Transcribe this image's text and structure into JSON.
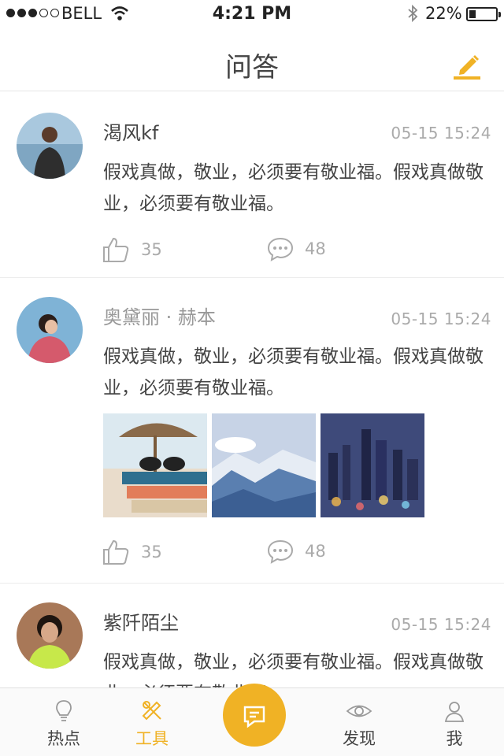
{
  "status_bar": {
    "carrier": "BELL",
    "time": "4:21 PM",
    "battery": "22%",
    "battery_level": 0.22
  },
  "navbar": {
    "title": "问答",
    "compose_icon": "pencil-icon"
  },
  "posts": [
    {
      "username": "渴风kf",
      "time": "05-15  15:24",
      "content": "假戏真做，敬业，必须要有敬业福。假戏真做敬业，必须要有敬业福。",
      "likes": "35",
      "comments": "48"
    },
    {
      "username": "奥黛丽 · 赫本",
      "time": "05-15  15:24",
      "content": "假戏真做，敬业，必须要有敬业福。假戏真做敬业，必须要有敬业福。",
      "likes": "35",
      "comments": "48",
      "images": [
        "beach-books-photo",
        "snowy-mountains-photo",
        "city-night-photo"
      ]
    },
    {
      "username": "紫阡陌尘",
      "time": "05-15  15:24",
      "content": "假戏真做，敬业，必须要有敬业福。假戏真做敬业，必须要有敬业福。"
    }
  ],
  "tabbar": {
    "tabs": [
      {
        "label": "热点",
        "icon": "lightbulb-icon"
      },
      {
        "label": "工具",
        "icon": "tools-icon"
      },
      {
        "label": "发现",
        "icon": "eye-icon"
      },
      {
        "label": "我",
        "icon": "user-icon"
      }
    ],
    "center_icon": "chat-icon",
    "active_color": "#f0b225"
  },
  "colors": {
    "accent": "#f0b225",
    "muted_text": "#aaaaaa"
  }
}
